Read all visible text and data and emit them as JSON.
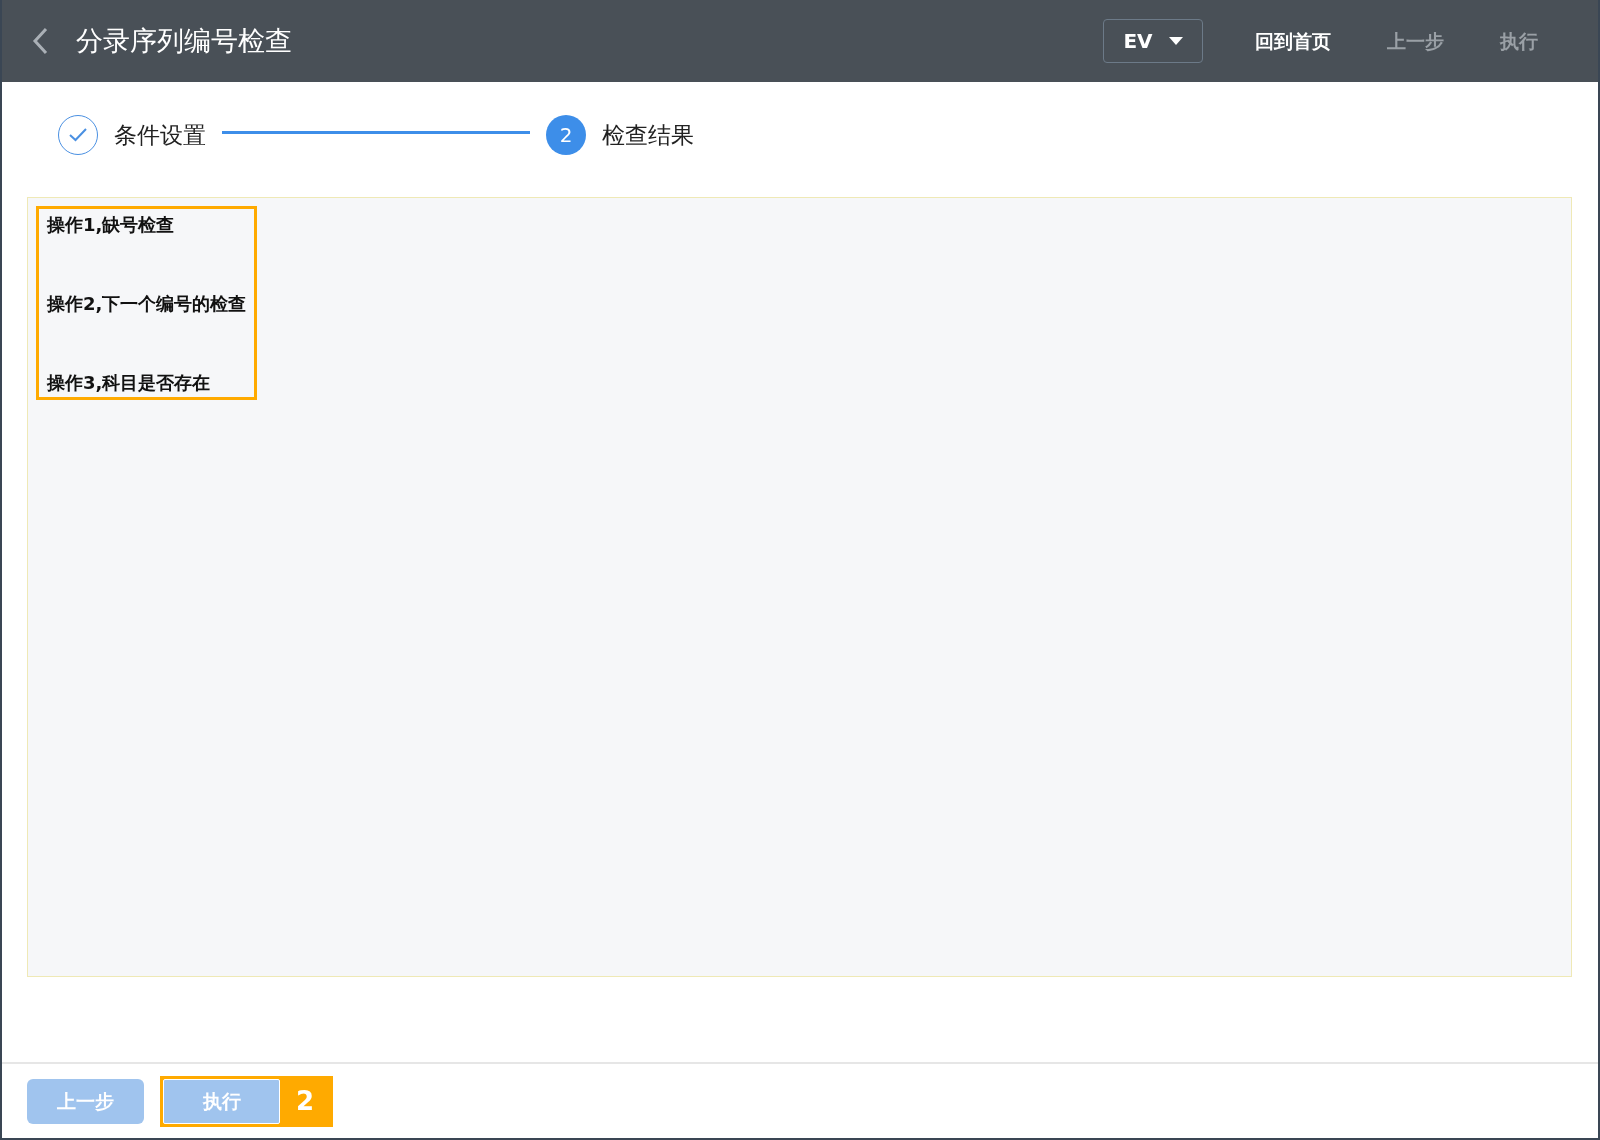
{
  "header": {
    "title": "分录序列编号检查",
    "dropdown": "EV",
    "actions": [
      {
        "label": "回到首页",
        "disabled": false
      },
      {
        "label": "上一步",
        "disabled": true
      },
      {
        "label": "执行",
        "disabled": true
      }
    ]
  },
  "steps": [
    {
      "label": "条件设置",
      "completed": true
    },
    {
      "label": "检查结果",
      "number": "2",
      "completed": false
    }
  ],
  "results": {
    "highlighted": true,
    "lines": [
      "操作1,缺号检查",
      "操作2,下一个编号的检查",
      "操作3,科目是否存在"
    ]
  },
  "footer": {
    "buttons": [
      {
        "label": "上一步",
        "disabled": true,
        "highlighted": false
      },
      {
        "label": "执行",
        "disabled": true,
        "highlighted": true
      }
    ],
    "callout": "2"
  }
}
